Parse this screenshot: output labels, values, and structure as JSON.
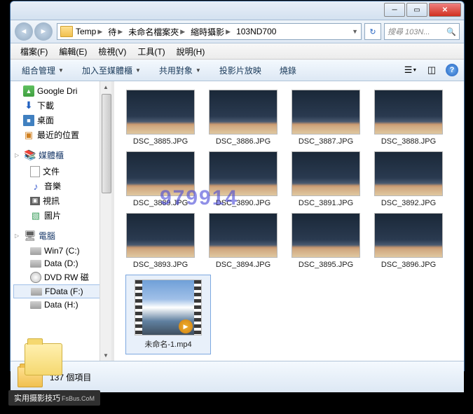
{
  "breadcrumb": [
    "Temp",
    "待",
    "未命名檔案夾",
    "縮時攝影",
    "103ND700"
  ],
  "searchPlaceholder": "搜尋 103N...",
  "menus": [
    "檔案(F)",
    "編輯(E)",
    "檢視(V)",
    "工具(T)",
    "說明(H)"
  ],
  "toolbar": {
    "organize": "組合管理",
    "include": "加入至媒體櫃",
    "share": "共用對象",
    "slideshow": "投影片放映",
    "burn": "燒錄"
  },
  "sidebar": {
    "fav": [
      {
        "icon": "gd",
        "label": "Google Dri"
      },
      {
        "icon": "dl",
        "label": "下載"
      },
      {
        "icon": "desk",
        "label": "桌面"
      },
      {
        "icon": "rec",
        "label": "最近的位置"
      }
    ],
    "lib": {
      "header": "媒體櫃",
      "items": [
        {
          "icon": "doc",
          "label": "文件"
        },
        {
          "icon": "mus",
          "label": "音樂"
        },
        {
          "icon": "vid",
          "label": "視訊"
        },
        {
          "icon": "pic",
          "label": "圖片"
        }
      ]
    },
    "comp": {
      "header": "電腦",
      "items": [
        {
          "icon": "drv",
          "label": "Win7 (C:)"
        },
        {
          "icon": "drv",
          "label": "Data (D:)"
        },
        {
          "icon": "dvd",
          "label": "DVD RW 磁"
        },
        {
          "icon": "drv",
          "label": "FData (F:)"
        },
        {
          "icon": "drv",
          "label": "Data (H:)"
        }
      ]
    }
  },
  "files": {
    "images": [
      "DSC_3885.JPG",
      "DSC_3886.JPG",
      "DSC_3887.JPG",
      "DSC_3888.JPG",
      "DSC_3889.JPG",
      "DSC_3890.JPG",
      "DSC_3891.JPG",
      "DSC_3892.JPG",
      "DSC_3893.JPG",
      "DSC_3894.JPG",
      "DSC_3895.JPG",
      "DSC_3896.JPG"
    ],
    "video": "未命名-1.mp4"
  },
  "status": "137 個項目",
  "watermark": "979914",
  "credit": {
    "main": "实用摄影技巧",
    "sub": "FsBus.CoM"
  }
}
